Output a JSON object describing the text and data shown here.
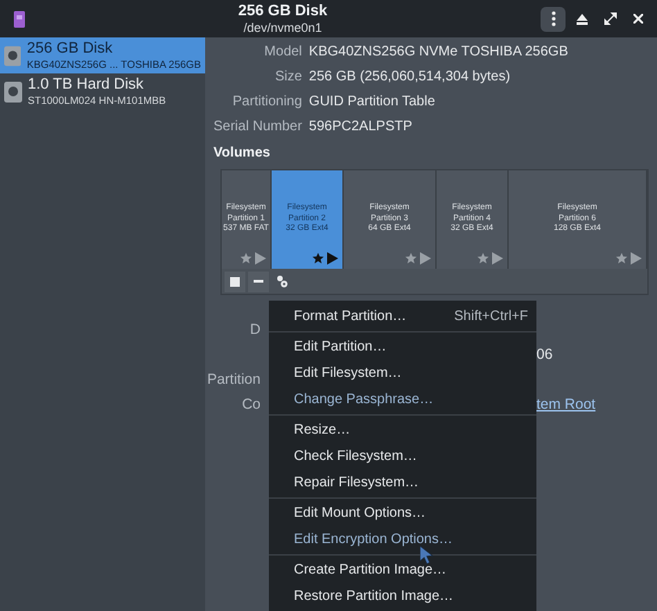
{
  "window": {
    "title": "256 GB Disk",
    "subtitle": "/dev/nvme0n1"
  },
  "sidebar": {
    "items": [
      {
        "name": "256 GB Disk",
        "detail": "KBG40ZNS256G ... TOSHIBA 256GB",
        "selected": true
      },
      {
        "name": "1.0 TB Hard Disk",
        "detail": "ST1000LM024 HN-M101MBB",
        "selected": false
      }
    ]
  },
  "details": [
    {
      "label": "Model",
      "value": "KBG40ZNS256G NVMe TOSHIBA 256GB"
    },
    {
      "label": "Size",
      "value": "256 GB (256,060,514,304 bytes)"
    },
    {
      "label": "Partitioning",
      "value": "GUID Partition Table"
    },
    {
      "label": "Serial Number",
      "value": "596PC2ALPSTP"
    }
  ],
  "volumes": {
    "heading": "Volumes",
    "partitions": [
      {
        "lines": [
          "Filesystem",
          "Partition 1",
          "537 MB FAT"
        ],
        "selected": false
      },
      {
        "lines": [
          "Filesystem",
          "Partition 2",
          "32 GB Ext4"
        ],
        "selected": true
      },
      {
        "lines": [
          "Filesystem",
          "Partition 3",
          "64 GB Ext4"
        ],
        "selected": false
      },
      {
        "lines": [
          "Filesystem",
          "Partition 4",
          "32 GB Ext4"
        ],
        "selected": false
      },
      {
        "lines": [
          "Filesystem",
          "Partition 6",
          "128 GB Ext4"
        ],
        "selected": false
      }
    ]
  },
  "partition_details": [
    {
      "label": "D"
    },
    {
      "value": "06"
    },
    {
      "label": "Partition"
    },
    {
      "label": "Co",
      "value": "tem Root",
      "kind": "link"
    }
  ],
  "menu": {
    "groups": [
      [
        {
          "label": "Format Partition…",
          "shortcut": "Shift+Ctrl+F",
          "disabled": false
        }
      ],
      [
        {
          "label": "Edit Partition…",
          "disabled": false
        },
        {
          "label": "Edit Filesystem…",
          "disabled": false
        },
        {
          "label": "Change Passphrase…",
          "disabled": true
        }
      ],
      [
        {
          "label": "Resize…",
          "disabled": false
        },
        {
          "label": "Check Filesystem…",
          "disabled": false
        },
        {
          "label": "Repair Filesystem…",
          "disabled": false
        }
      ],
      [
        {
          "label": "Edit Mount Options…",
          "disabled": false
        },
        {
          "label": "Edit Encryption Options…",
          "disabled": true
        }
      ],
      [
        {
          "label": "Create Partition Image…",
          "disabled": false
        },
        {
          "label": "Restore Partition Image…",
          "disabled": false
        }
      ]
    ]
  }
}
